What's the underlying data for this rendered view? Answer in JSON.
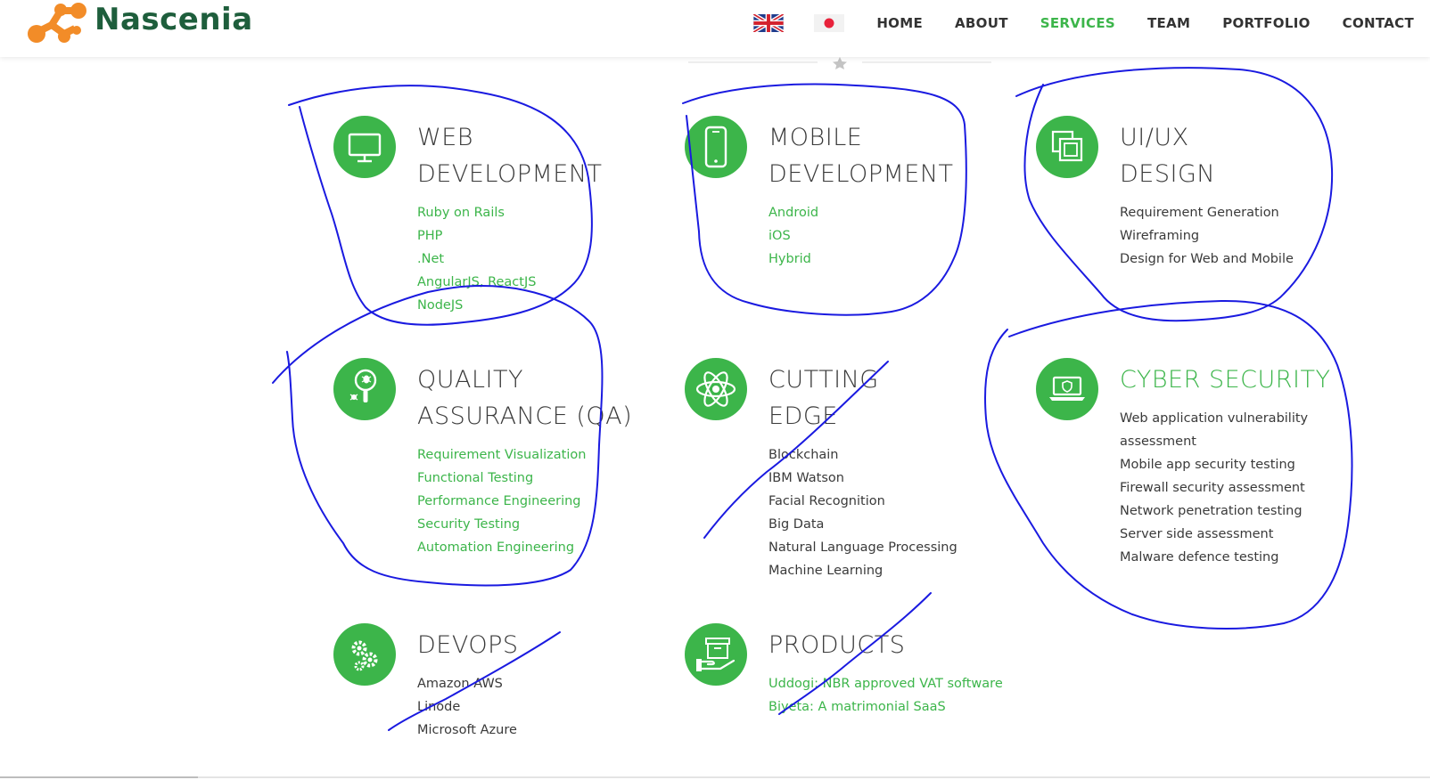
{
  "brand": {
    "name": "Nascenia",
    "logo_color": "#f28c28",
    "text_color": "#1e5e3c"
  },
  "accent": "#3cb54a",
  "nav": {
    "flags": [
      "uk-flag-icon",
      "japan-flag-icon"
    ],
    "items": [
      {
        "label": "HOME",
        "active": false
      },
      {
        "label": "ABOUT",
        "active": false
      },
      {
        "label": "SERVICES",
        "active": true
      },
      {
        "label": "TEAM",
        "active": false
      },
      {
        "label": "PORTFOLIO",
        "active": false
      },
      {
        "label": "CONTACT",
        "active": false
      }
    ]
  },
  "services": [
    {
      "id": "web",
      "icon": "monitor-icon",
      "title_lines": [
        "WEB",
        "DEVELOPMENT"
      ],
      "items": [
        "Ruby on Rails",
        "PHP",
        ".Net",
        "AngularJS, ReactJS",
        "NodeJS"
      ],
      "items_green": true
    },
    {
      "id": "mobile",
      "icon": "smartphone-icon",
      "title_lines": [
        "MOBILE",
        "DEVELOPMENT"
      ],
      "items": [
        "Android",
        "iOS",
        "Hybrid"
      ],
      "items_green": true
    },
    {
      "id": "uiux",
      "icon": "layers-icon",
      "title_lines": [
        "UI/UX",
        "DESIGN"
      ],
      "items": [
        "Requirement Generation",
        "Wireframing",
        "Design for Web and Mobile"
      ],
      "items_green": false
    },
    {
      "id": "qa",
      "icon": "magnifier-bug-icon",
      "title_lines": [
        "QUALITY",
        "ASSURANCE (QA)"
      ],
      "items": [
        "Requirement Visualization",
        "Functional Testing",
        "Performance Engineering",
        "Security Testing",
        "Automation Engineering"
      ],
      "items_green": true
    },
    {
      "id": "cutting",
      "icon": "atom-icon",
      "title_lines": [
        "CUTTING",
        "EDGE"
      ],
      "items": [
        "Blockchain",
        "IBM Watson",
        "Facial Recognition",
        "Big Data",
        "Natural Language Processing",
        "Machine Learning"
      ],
      "items_green": false
    },
    {
      "id": "cyber",
      "icon": "laptop-shield-icon",
      "title_lines": [
        "CYBER SECURITY"
      ],
      "title_green": true,
      "items": [
        "Web application vulnerability",
        "assessment",
        "Mobile app security testing",
        "Firewall security assessment",
        "Network penetration testing",
        "Server side assessment",
        "Malware defence testing"
      ],
      "items_green": false
    },
    {
      "id": "devops",
      "icon": "gears-icon",
      "title_lines": [
        "DEVOPS"
      ],
      "items": [
        "Amazon AWS",
        "Linode",
        "Microsoft Azure"
      ],
      "items_green": false
    },
    {
      "id": "products",
      "icon": "box-hand-icon",
      "title_lines": [
        "PRODUCTS"
      ],
      "items": [
        "Uddogi: NBR approved VAT software",
        "Biyeta: A matrimonial SaaS"
      ],
      "items_green": true
    }
  ],
  "annotation_color": "#1a1ae0"
}
